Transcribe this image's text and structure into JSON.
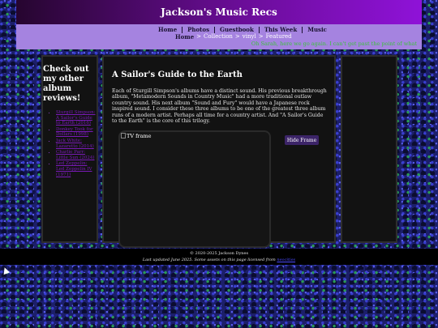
{
  "header": {
    "title": "Jackson's Music Recs"
  },
  "nav": {
    "items": [
      "Home",
      "Photos",
      "Guestbook",
      "This Week",
      "Music"
    ]
  },
  "breadcrumb": {
    "home": "Home",
    "sep1": ">",
    "collection": "Collection",
    "sep2": ">",
    "vinyl": "vinyl",
    "sep3": ">",
    "current": "Featured"
  },
  "marquee": "Oh Sarah, here we go again. I can't get past the point of what",
  "sidebar": {
    "heading": "Check out my other album reviews!",
    "reviews": [
      "Sturgill Simpson: A Sailor's Guide to Earth (2016)",
      "Donkey Took for Dollars (1998)",
      "Jack White: Lazaretto (2014)",
      "Charlie Parr: Little Sun (2024)",
      "Led Zeppelin: Led Zeppelin IV (1971)"
    ]
  },
  "main": {
    "title": "A Sailor's Guide to the Earth",
    "body": "Each of Sturgill Simpson's albums have a distinct sound. His previous breakthrough album, \"Metamodern Sounds in Country Music\" had a more traditional outlaw country sound. His next album \"Sound and Fury\" would have a Japanese rock inspired sound. I consider these three albums to be one of the greatest three album runs of a modern artist. Perhaps all time for a country artist. And \"A Sailor's Guide to the Earth\" is the core of this trilogy.",
    "tv_frame_alt": "TV frame",
    "hide_button": "Hide Frame"
  },
  "footer": {
    "copyright": "© 2020-2025 Jackson Dynes",
    "updated": "Last updated June 2025. Some assets on this page licensed from",
    "link": "neocities"
  }
}
